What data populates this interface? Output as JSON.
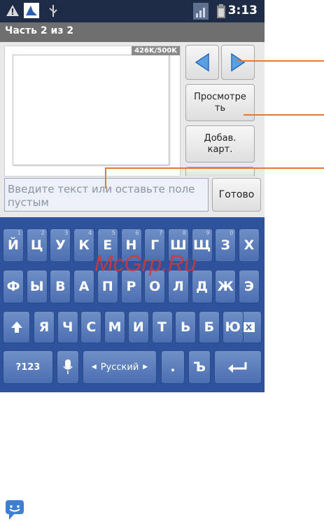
{
  "status": {
    "time": "3:13",
    "icons": [
      "warning-icon",
      "dolphin-icon",
      "usb-icon",
      "signal-icon",
      "battery-icon"
    ]
  },
  "title": "Часть 2 из 2",
  "slide": {
    "size": "426K/500K"
  },
  "buttons": {
    "prev_icon": "prev-slide-icon",
    "next_icon": "next-slide-icon",
    "preview": "Просмотреть",
    "add_picture": "Добав. карт.",
    "done": "Готово"
  },
  "input": {
    "placeholder": "Введите текст или оставьте поле пустым"
  },
  "keyboard": {
    "row1": [
      {
        "k": "Й",
        "h": "1"
      },
      {
        "k": "Ц",
        "h": "2"
      },
      {
        "k": "У",
        "h": "3"
      },
      {
        "k": "К",
        "h": "4"
      },
      {
        "k": "Е",
        "h": "5"
      },
      {
        "k": "Н",
        "h": "6"
      },
      {
        "k": "Г",
        "h": "7"
      },
      {
        "k": "Ш",
        "h": "8"
      },
      {
        "k": "Щ",
        "h": "9"
      },
      {
        "k": "З",
        "h": "0"
      },
      {
        "k": "Х",
        "h": ""
      }
    ],
    "row2": [
      "Ф",
      "Ы",
      "В",
      "А",
      "П",
      "Р",
      "О",
      "Л",
      "Д",
      "Ж",
      "Э"
    ],
    "row3": [
      "Я",
      "Ч",
      "С",
      "М",
      "И",
      "Т",
      "Ь",
      "Б",
      "Ю"
    ],
    "numeric_label": "?123",
    "language_label": "Русский",
    "period_label": ".",
    "hard_sign": "Ъ"
  },
  "watermark": "McGrp.Ru",
  "colors": {
    "accent": "#e07a3a",
    "keyboard": "#2e539c"
  }
}
